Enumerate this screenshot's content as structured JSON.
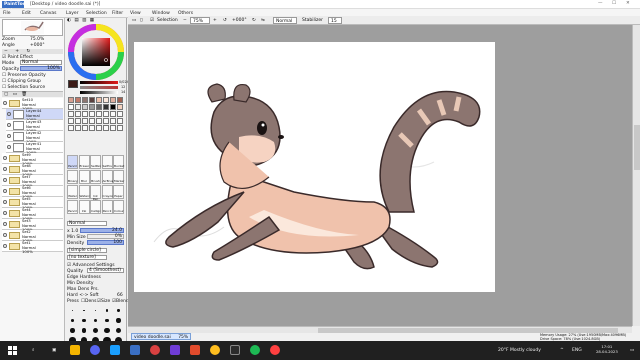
{
  "app": {
    "logo": "PaintTool SAI",
    "window_title": "[Desktop / video doodle.sai (*)]"
  },
  "menu": [
    "File",
    "Edit",
    "Canvas",
    "Layer",
    "Selection",
    "Filter",
    "View",
    "Window",
    "Others"
  ],
  "toolbar": {
    "selection_label": "Selection",
    "zoom_value": "75%",
    "angle_value": "+000°",
    "blend_mode": "Normal",
    "stabilizer_label": "Stabilizer",
    "stabilizer_value": "15"
  },
  "nav": {
    "zoom_label": "Zoom",
    "zoom_value": "75.0%",
    "angle_label": "Angle",
    "angle_value": "+000°"
  },
  "layer_props": {
    "paint_effect": "Paint Effect",
    "mode_label": "Mode",
    "mode_value": "Normal",
    "opacity_label": "Opacity",
    "opacity_value": "100%",
    "preserve_opacity": "Preserve Opacity",
    "clipping_group": "Clipping Group",
    "selection_source": "Selection Source"
  },
  "layers": [
    {
      "name": "Set10",
      "mode": "Normal",
      "opacity": "100%",
      "type": "folder",
      "selected": false
    },
    {
      "name": "Layer44",
      "mode": "Normal",
      "opacity": "100%",
      "type": "layer",
      "selected": true
    },
    {
      "name": "Layer43",
      "mode": "Normal",
      "opacity": "100%",
      "type": "layer",
      "selected": false
    },
    {
      "name": "Layer42",
      "mode": "Normal",
      "opacity": "100%",
      "type": "layer",
      "selected": false
    },
    {
      "name": "Layer41",
      "mode": "Normal",
      "opacity": "100%",
      "type": "layer",
      "selected": false
    },
    {
      "name": "Set9",
      "mode": "Normal",
      "opacity": "100%",
      "type": "folder",
      "selected": false
    },
    {
      "name": "Set8",
      "mode": "Normal",
      "opacity": "100%",
      "type": "folder",
      "selected": false
    },
    {
      "name": "Set7",
      "mode": "Normal",
      "opacity": "100%",
      "type": "folder",
      "selected": false
    },
    {
      "name": "Set6",
      "mode": "Normal",
      "opacity": "100%",
      "type": "folder",
      "selected": false
    },
    {
      "name": "Set5",
      "mode": "Normal",
      "opacity": "100%",
      "type": "folder",
      "selected": false
    },
    {
      "name": "Set4",
      "mode": "Normal",
      "opacity": "100%",
      "type": "folder",
      "selected": false
    },
    {
      "name": "Set3",
      "mode": "Normal",
      "opacity": "100%",
      "type": "folder",
      "selected": false
    },
    {
      "name": "Set2",
      "mode": "Normal",
      "opacity": "100%",
      "type": "folder",
      "selected": false
    },
    {
      "name": "Set1",
      "mode": "Normal",
      "opacity": "100%",
      "type": "folder",
      "selected": false
    }
  ],
  "color": {
    "current": "#3b1a16",
    "hsv": [
      "0/024",
      "12",
      "14"
    ]
  },
  "tools": [
    "Pencil",
    "Eraser",
    "SelPen",
    "SelErs",
    "Bucket",
    "Binary",
    "Blur",
    "Brush",
    "AirBrush",
    "Marker",
    "Water",
    "Watercol",
    "Ink Pen",
    "Crayon",
    "Paper",
    "Pencil",
    "Ink",
    "Calligr.",
    "Pencil",
    "Colour"
  ],
  "brush": {
    "mode": "Normal",
    "size_label": "Max Size",
    "size_mult": "x 1.0",
    "size_value": "24.0",
    "min_size_label": "Min Size",
    "min_size_value": "0%",
    "density_label": "Density",
    "density_value": "100",
    "shape": "[simple circle]",
    "texture": "[no texture]",
    "advanced": "Advanced Settings",
    "quality_label": "Quality",
    "quality_value": "4 (Smoothest)",
    "edge_label": "Edge Hardness",
    "min_density_label": "Min Density",
    "max_dens_label": "Max Dens Prs.",
    "hard_soft_label": "Hard <-> Soft",
    "hard_soft_value": "66",
    "press_label": "Press",
    "dens_label": "Dens",
    "size_chk": "Size",
    "blend_chk": "Blend"
  },
  "status": {
    "file_tab": "video doodle.sai",
    "file_zoom": "75%",
    "memory": "Memory Usage: 27% (Use:1950MB/Max:4096MB)",
    "drive": "Drive Space: 78% (Use:1024.8GB)"
  },
  "taskbar": {
    "weather": "20°F  Mostly cloudy",
    "lang": "ENG",
    "time": "17:01",
    "date": "28.04.2023"
  }
}
